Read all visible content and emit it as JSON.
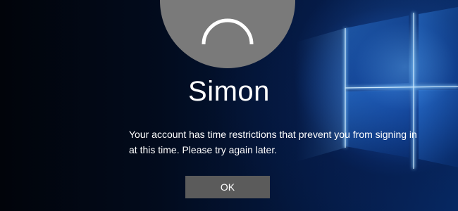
{
  "lock_screen": {
    "username": "Simon",
    "message": "Your account has time restrictions that prevent you from signing in at this time. Please try again later.",
    "ok_label": "OK",
    "avatar_icon": "user-silhouette-icon",
    "background_logo": "windows-logo-icon"
  },
  "colors": {
    "avatar_bg": "#7a7a7a",
    "button_bg": "#5b5b5b",
    "text": "#ffffff",
    "logo_glow": "#7cc4ff"
  }
}
